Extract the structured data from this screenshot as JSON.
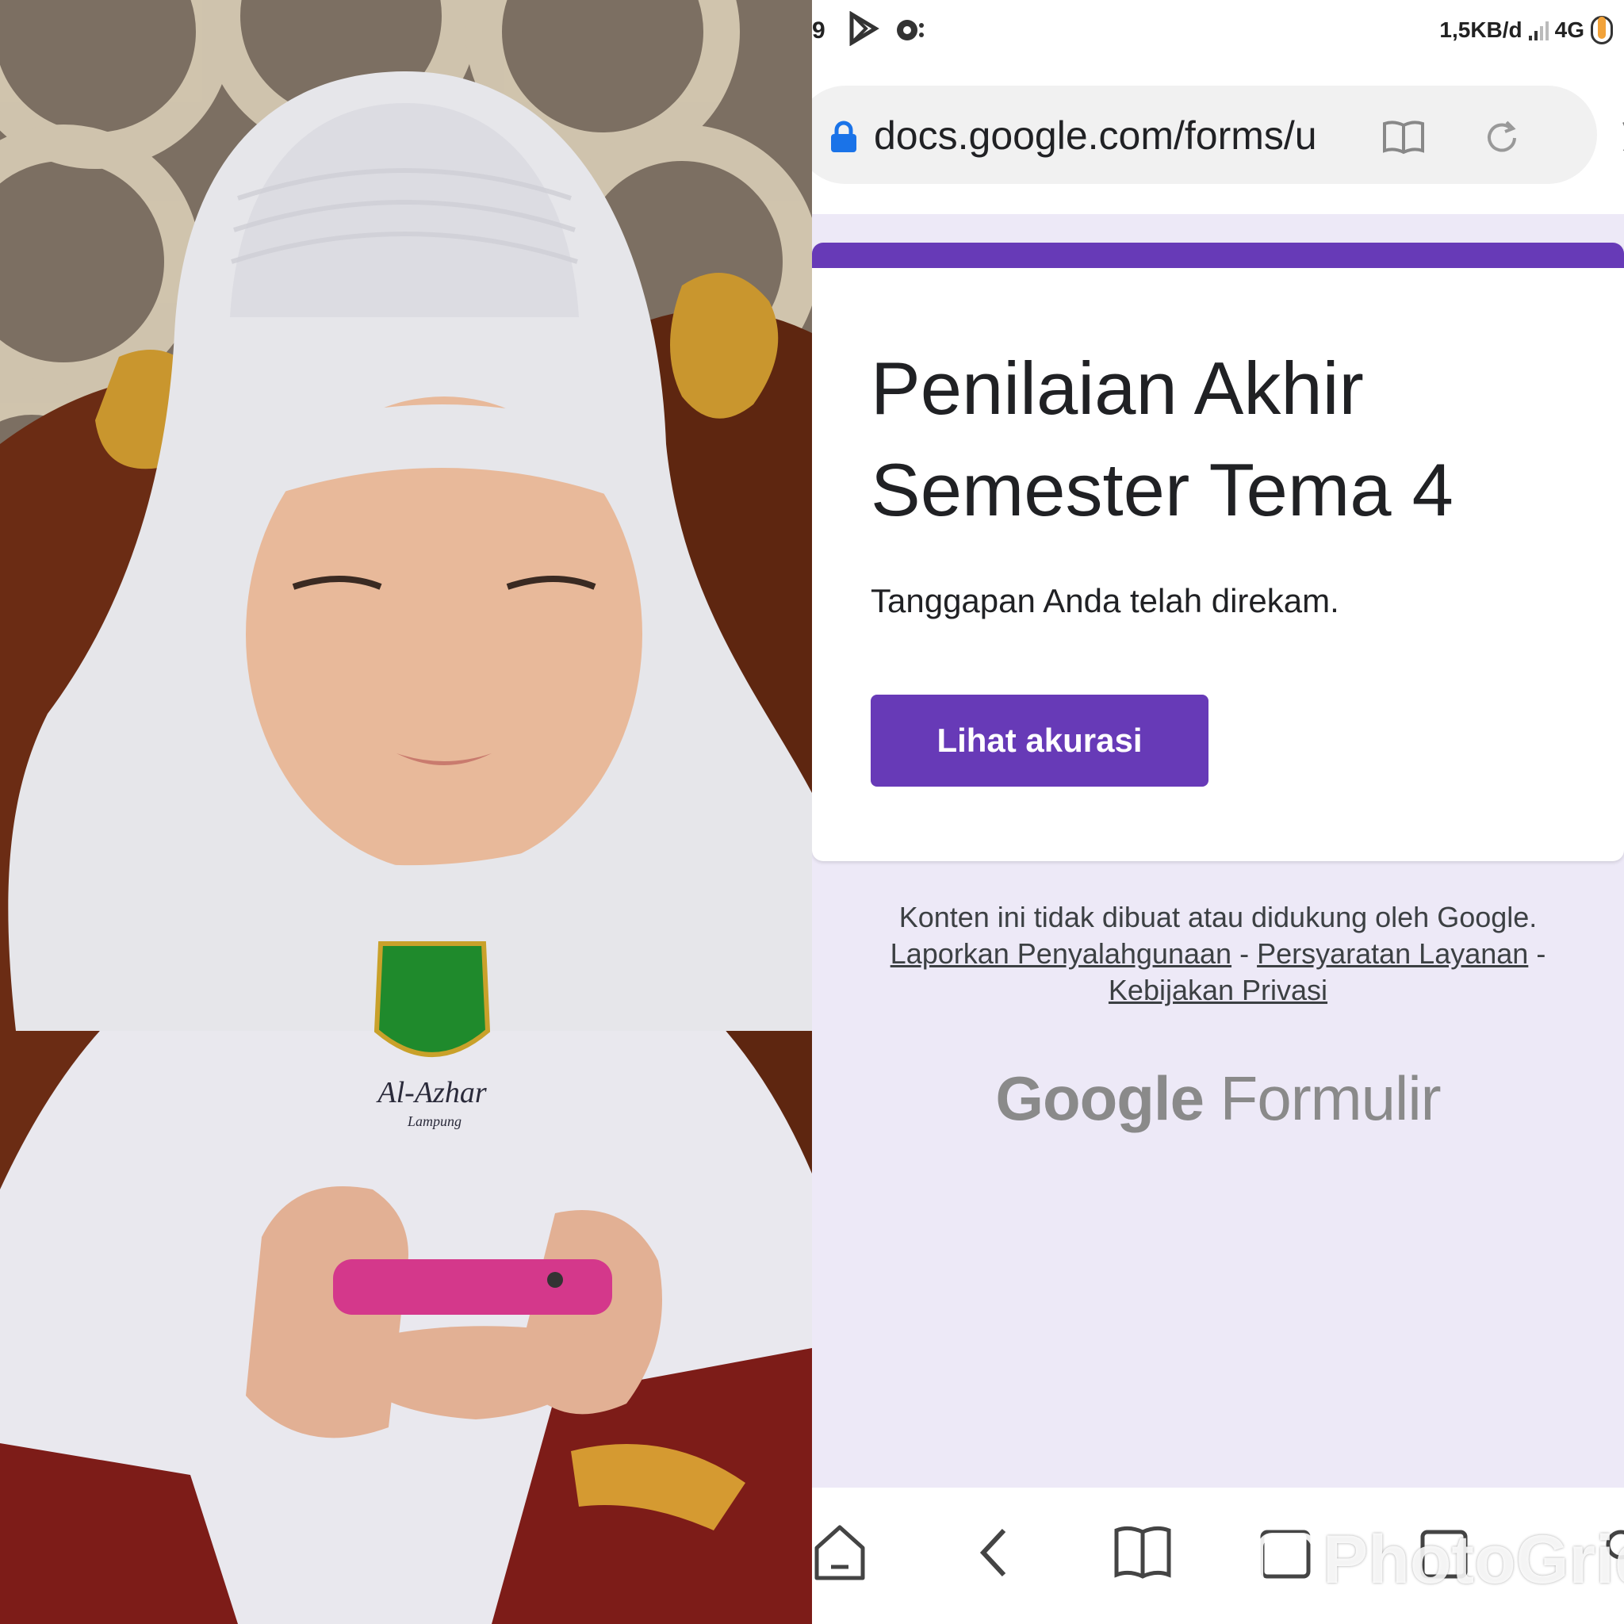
{
  "photo": {
    "badge_text": "Al-Azhar",
    "badge_subtext": "Lampung"
  },
  "status_bar": {
    "time_fragment": "9",
    "network_speed": "1,5KB/d",
    "network_type": "4G"
  },
  "browser": {
    "url": "docs.google.com/forms/u",
    "icons": [
      "lock-icon",
      "reader-mode-icon",
      "reload-icon",
      "star-icon"
    ]
  },
  "form": {
    "accent_color": "#673ab7",
    "title": "Penilaian Akhir Semester Tema 4",
    "confirmation": "Tanggapan Anda telah direkam.",
    "button_label": "Lihat akurasi"
  },
  "footer": {
    "disclaimer": "Konten ini tidak dibuat atau didukung oleh Google.",
    "link_report": "Laporkan Penyalahgunaan",
    "separator": "-",
    "link_terms": "Persyaratan Layanan",
    "link_privacy": "Kebijakan Privasi"
  },
  "brand": {
    "google": "Google",
    "product": "Formulir"
  },
  "nav": {
    "items": [
      "home-icon",
      "back-icon",
      "bookmarks-icon",
      "tabs-icon",
      "menu-icon"
    ]
  },
  "watermark": "PhotoGrid"
}
